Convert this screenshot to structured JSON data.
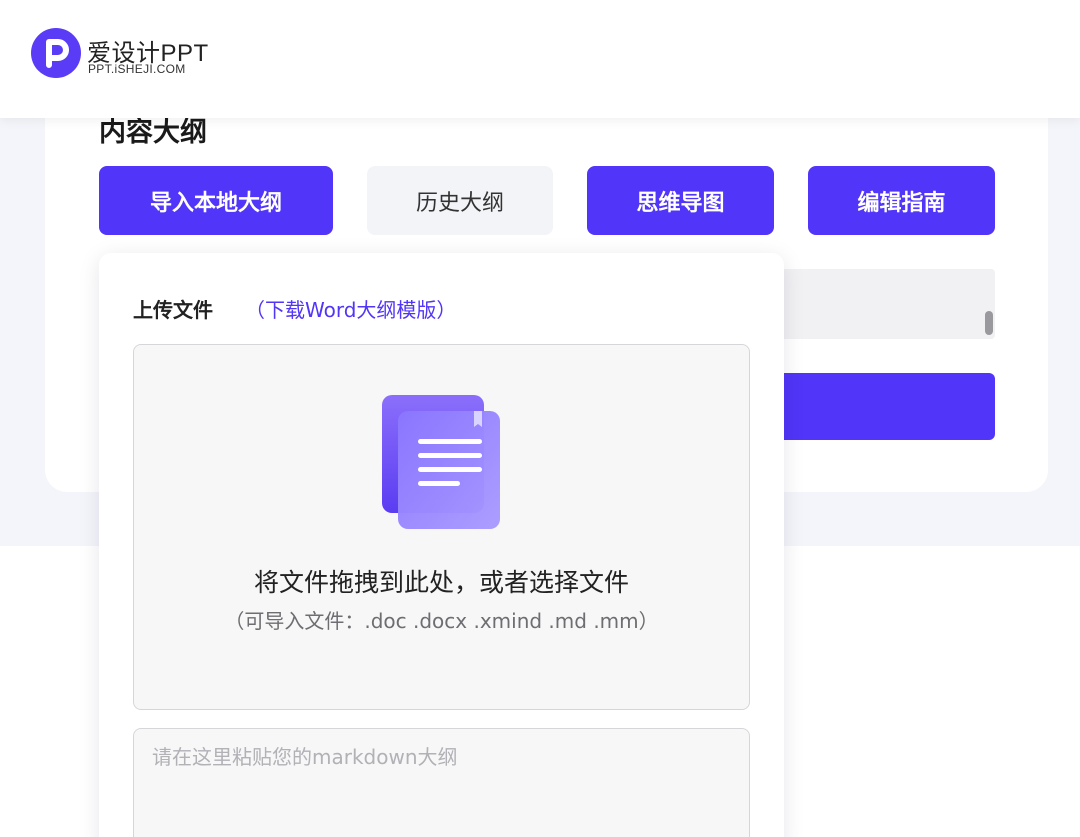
{
  "header": {
    "logo_title": "爱设计PPT",
    "logo_subtitle": "PPT.iSHEJI.COM",
    "logo_letter": "P"
  },
  "outline": {
    "title": "内容大纲",
    "buttons": {
      "import_local": "导入本地大纲",
      "history": "历史大纲",
      "mind_map": "思维导图",
      "edit_guide": "编辑指南"
    }
  },
  "upload_popup": {
    "upload_label": "上传文件",
    "download_template_link": "（下载Word大纲模版）",
    "drop_main_text": "将文件拖拽到此处，或者选择文件",
    "drop_formats_text": "（可导入文件：.doc .docx .xmind .md .mm）",
    "markdown_placeholder": "请在这里粘贴您的markdown大纲"
  },
  "colors": {
    "accent": "#5135f8",
    "page_background": "#f4f5fa",
    "secondary_button": "#f3f4f7"
  }
}
